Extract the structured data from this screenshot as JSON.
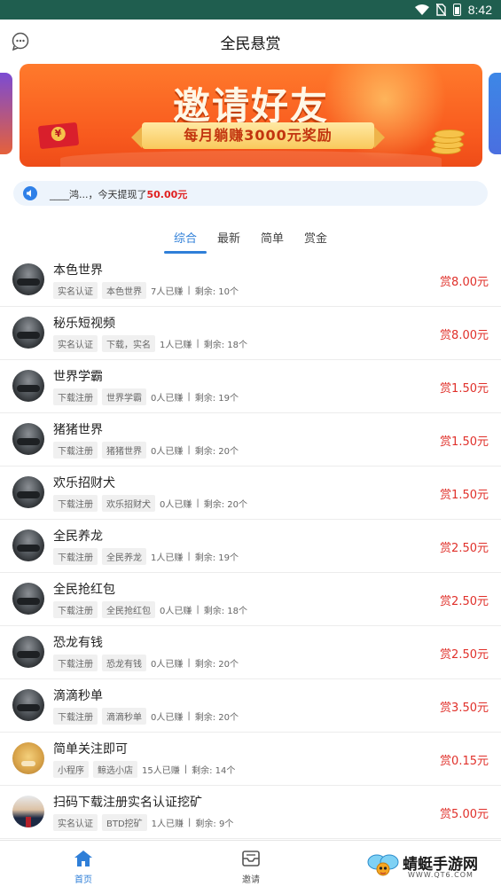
{
  "status_bar": {
    "time": "8:42"
  },
  "header": {
    "title": "全民悬赏",
    "left_icon": "chat-bubble-icon"
  },
  "banner": {
    "headline": "邀请好友",
    "subline": "每月躺赚3000元奖励"
  },
  "notice": {
    "text": "____鸿...，今天提现了",
    "amount": "50.00元"
  },
  "tabs": [
    {
      "label": "综合",
      "active": true
    },
    {
      "label": "最新",
      "active": false
    },
    {
      "label": "简单",
      "active": false
    },
    {
      "label": "赏金",
      "active": false
    }
  ],
  "tasks": [
    {
      "name": "本色世界",
      "tag1": "实名认证",
      "tag2": "本色世界",
      "earned": "7人已赚",
      "remaining": "剩余: 10个",
      "reward": "赏8.00元",
      "avatar": "car"
    },
    {
      "name": "秘乐短视频",
      "tag1": "实名认证",
      "tag2": "下载，实名",
      "earned": "1人已赚",
      "remaining": "剩余: 18个",
      "reward": "赏8.00元",
      "avatar": "car"
    },
    {
      "name": "世界学霸",
      "tag1": "下载注册",
      "tag2": "世界学霸",
      "earned": "0人已赚",
      "remaining": "剩余: 19个",
      "reward": "赏1.50元",
      "avatar": "car"
    },
    {
      "name": "猪猪世界",
      "tag1": "下载注册",
      "tag2": "猪猪世界",
      "earned": "0人已赚",
      "remaining": "剩余: 20个",
      "reward": "赏1.50元",
      "avatar": "car"
    },
    {
      "name": "欢乐招财犬",
      "tag1": "下载注册",
      "tag2": "欢乐招财犬",
      "earned": "0人已赚",
      "remaining": "剩余: 20个",
      "reward": "赏1.50元",
      "avatar": "car"
    },
    {
      "name": "全民养龙",
      "tag1": "下载注册",
      "tag2": "全民养龙",
      "earned": "1人已赚",
      "remaining": "剩余: 19个",
      "reward": "赏2.50元",
      "avatar": "car"
    },
    {
      "name": "全民抢红包",
      "tag1": "下载注册",
      "tag2": "全民抢红包",
      "earned": "0人已赚",
      "remaining": "剩余: 18个",
      "reward": "赏2.50元",
      "avatar": "car"
    },
    {
      "name": "恐龙有钱",
      "tag1": "下载注册",
      "tag2": "恐龙有钱",
      "earned": "0人已赚",
      "remaining": "剩余: 20个",
      "reward": "赏2.50元",
      "avatar": "car"
    },
    {
      "name": "滴滴秒单",
      "tag1": "下载注册",
      "tag2": "滴滴秒单",
      "earned": "0人已赚",
      "remaining": "剩余: 20个",
      "reward": "赏3.50元",
      "avatar": "car"
    },
    {
      "name": "简单关注即可",
      "tag1": "小程序",
      "tag2": "鲸选小店",
      "earned": "15人已赚",
      "remaining": "剩余: 14个",
      "reward": "赏0.15元",
      "avatar": "dog"
    },
    {
      "name": "扫码下载注册实名认证挖矿",
      "tag1": "实名认证",
      "tag2": "BTD挖矿",
      "earned": "1人已赚",
      "remaining": "剩余: 9个",
      "reward": "赏5.00元",
      "avatar": "person"
    }
  ],
  "bottom_nav": [
    {
      "label": "首页",
      "icon": "home-icon",
      "active": true
    },
    {
      "label": "邀请",
      "icon": "invite-mail-icon",
      "active": false
    }
  ],
  "watermark": {
    "name": "蜻蜓手游网",
    "url": "WWW.QT6.COM"
  },
  "colors": {
    "accent": "#2f7fd8",
    "reward": "#e0302a",
    "status_bar": "#1f5e4f",
    "banner": "#f85a1e"
  }
}
